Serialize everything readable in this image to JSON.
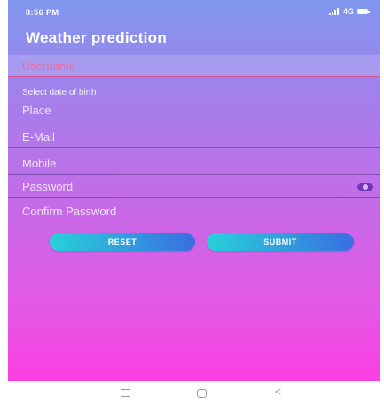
{
  "status_bar": {
    "time": "8:56 PM",
    "network": "4G"
  },
  "app_title": "Weather prediction",
  "form": {
    "username_placeholder": "Username",
    "dob_placeholder": "Select date of birth",
    "place_placeholder": "Place",
    "email_placeholder": "E-Mail",
    "mobile_placeholder": "Mobile",
    "password_placeholder": "Password",
    "confirm_password_placeholder": "Confirm Password"
  },
  "buttons": {
    "reset_label": "RESET",
    "submit_label": "SUBMIT"
  },
  "icons": {
    "password_toggle": "eye-icon",
    "nav_home": "menu-icon",
    "nav_recent": "square-icon",
    "nav_back": "back-icon"
  },
  "colors": {
    "gradient_top": "#7f97ef",
    "gradient_bottom": "#fb3fe2",
    "button_start": "#27d1d9",
    "button_end": "#3a6ee2"
  }
}
